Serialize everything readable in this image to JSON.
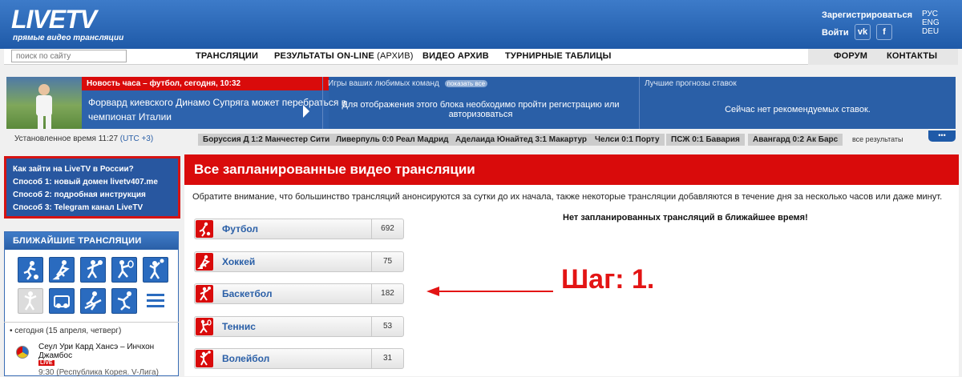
{
  "header": {
    "logo": "LIVETV",
    "logo_sub": "прямые видео трансляции",
    "register": "Зарегистрироваться",
    "login": "Войти",
    "social": [
      "vk-icon",
      "facebook-icon"
    ],
    "languages": [
      "РУС",
      "ENG",
      "DEU"
    ]
  },
  "nav": {
    "search_placeholder": "поиск по сайту",
    "items": [
      "ТРАНСЛЯЦИИ",
      "РЕЗУЛЬТАТЫ ON-LINE",
      "ВИДЕО АРХИВ",
      "ТУРНИРНЫЕ ТАБЛИЦЫ"
    ],
    "archive": "(АРХИВ)",
    "right_items": [
      "ФОРУМ",
      "КОНТАКТЫ"
    ]
  },
  "banner": {
    "news_head": "Новость часа – футбол, сегодня, 10:32",
    "news_text": "Форвард киевского Динамо Супряга может перебраться в чемпионат Италии",
    "games_head": "Игры ваших любимых команд",
    "games_badge": "показать все",
    "games_text": "Для отображения этого блока необходимо пройти регистрацию или авторизоваться",
    "bets_head": "Лучшие прогнозы ставок",
    "bets_text": "Сейчас нет рекомендуемых ставок."
  },
  "results_strip": {
    "time": "Установленное время 11:27",
    "tz": "(UTC +3)",
    "results": [
      "Боруссия Д 1:2 Манчестер Сити",
      "Ливерпуль 0:0 Реал Мадрид",
      "Аделаида Юнайтед 3:1 Макартур",
      "Челси 0:1 Порту",
      "ПСЖ 0:1 Бавария",
      "Авангард 0:2 Ак Барс"
    ],
    "all_results": "все результаты"
  },
  "howto": {
    "title": "Как зайти на LiveTV в России?",
    "ways": [
      "Способ 1: новый домен livetv407.me",
      "Способ 2: подробная инструкция",
      "Способ 3: Telegram канал LiveTV"
    ]
  },
  "nearest": {
    "title": "БЛИЖАЙШИЕ ТРАНСЛЯЦИИ",
    "today": "сегодня (15 апреля, четверг)",
    "match_teams": "Сеул Ури Кард Хансэ – Инчхон Джамбос",
    "match_info": "9:30 (Республика Корея. V-Лига)",
    "live_badge": "LIVE"
  },
  "main": {
    "title": "Все запланированные видео трансляции",
    "notice": "Обратите внимание, что большинство трансляций анонсируются за сутки до их начала, также некоторые трансляции добавляются в течение дня за несколько часов или даже минут.",
    "no_schedule": "Нет запланированных трансляций в ближайшее время!",
    "sports": [
      {
        "name": "Футбол",
        "count": "692"
      },
      {
        "name": "Хоккей",
        "count": "75"
      },
      {
        "name": "Баскетбол",
        "count": "182"
      },
      {
        "name": "Теннис",
        "count": "53"
      },
      {
        "name": "Волейбол",
        "count": "31"
      }
    ]
  },
  "annotation": {
    "step": "Шаг: 1.",
    "color": "#e31414"
  },
  "colors": {
    "brand_blue": "#2a5fa7",
    "brand_red": "#d90b0b"
  }
}
